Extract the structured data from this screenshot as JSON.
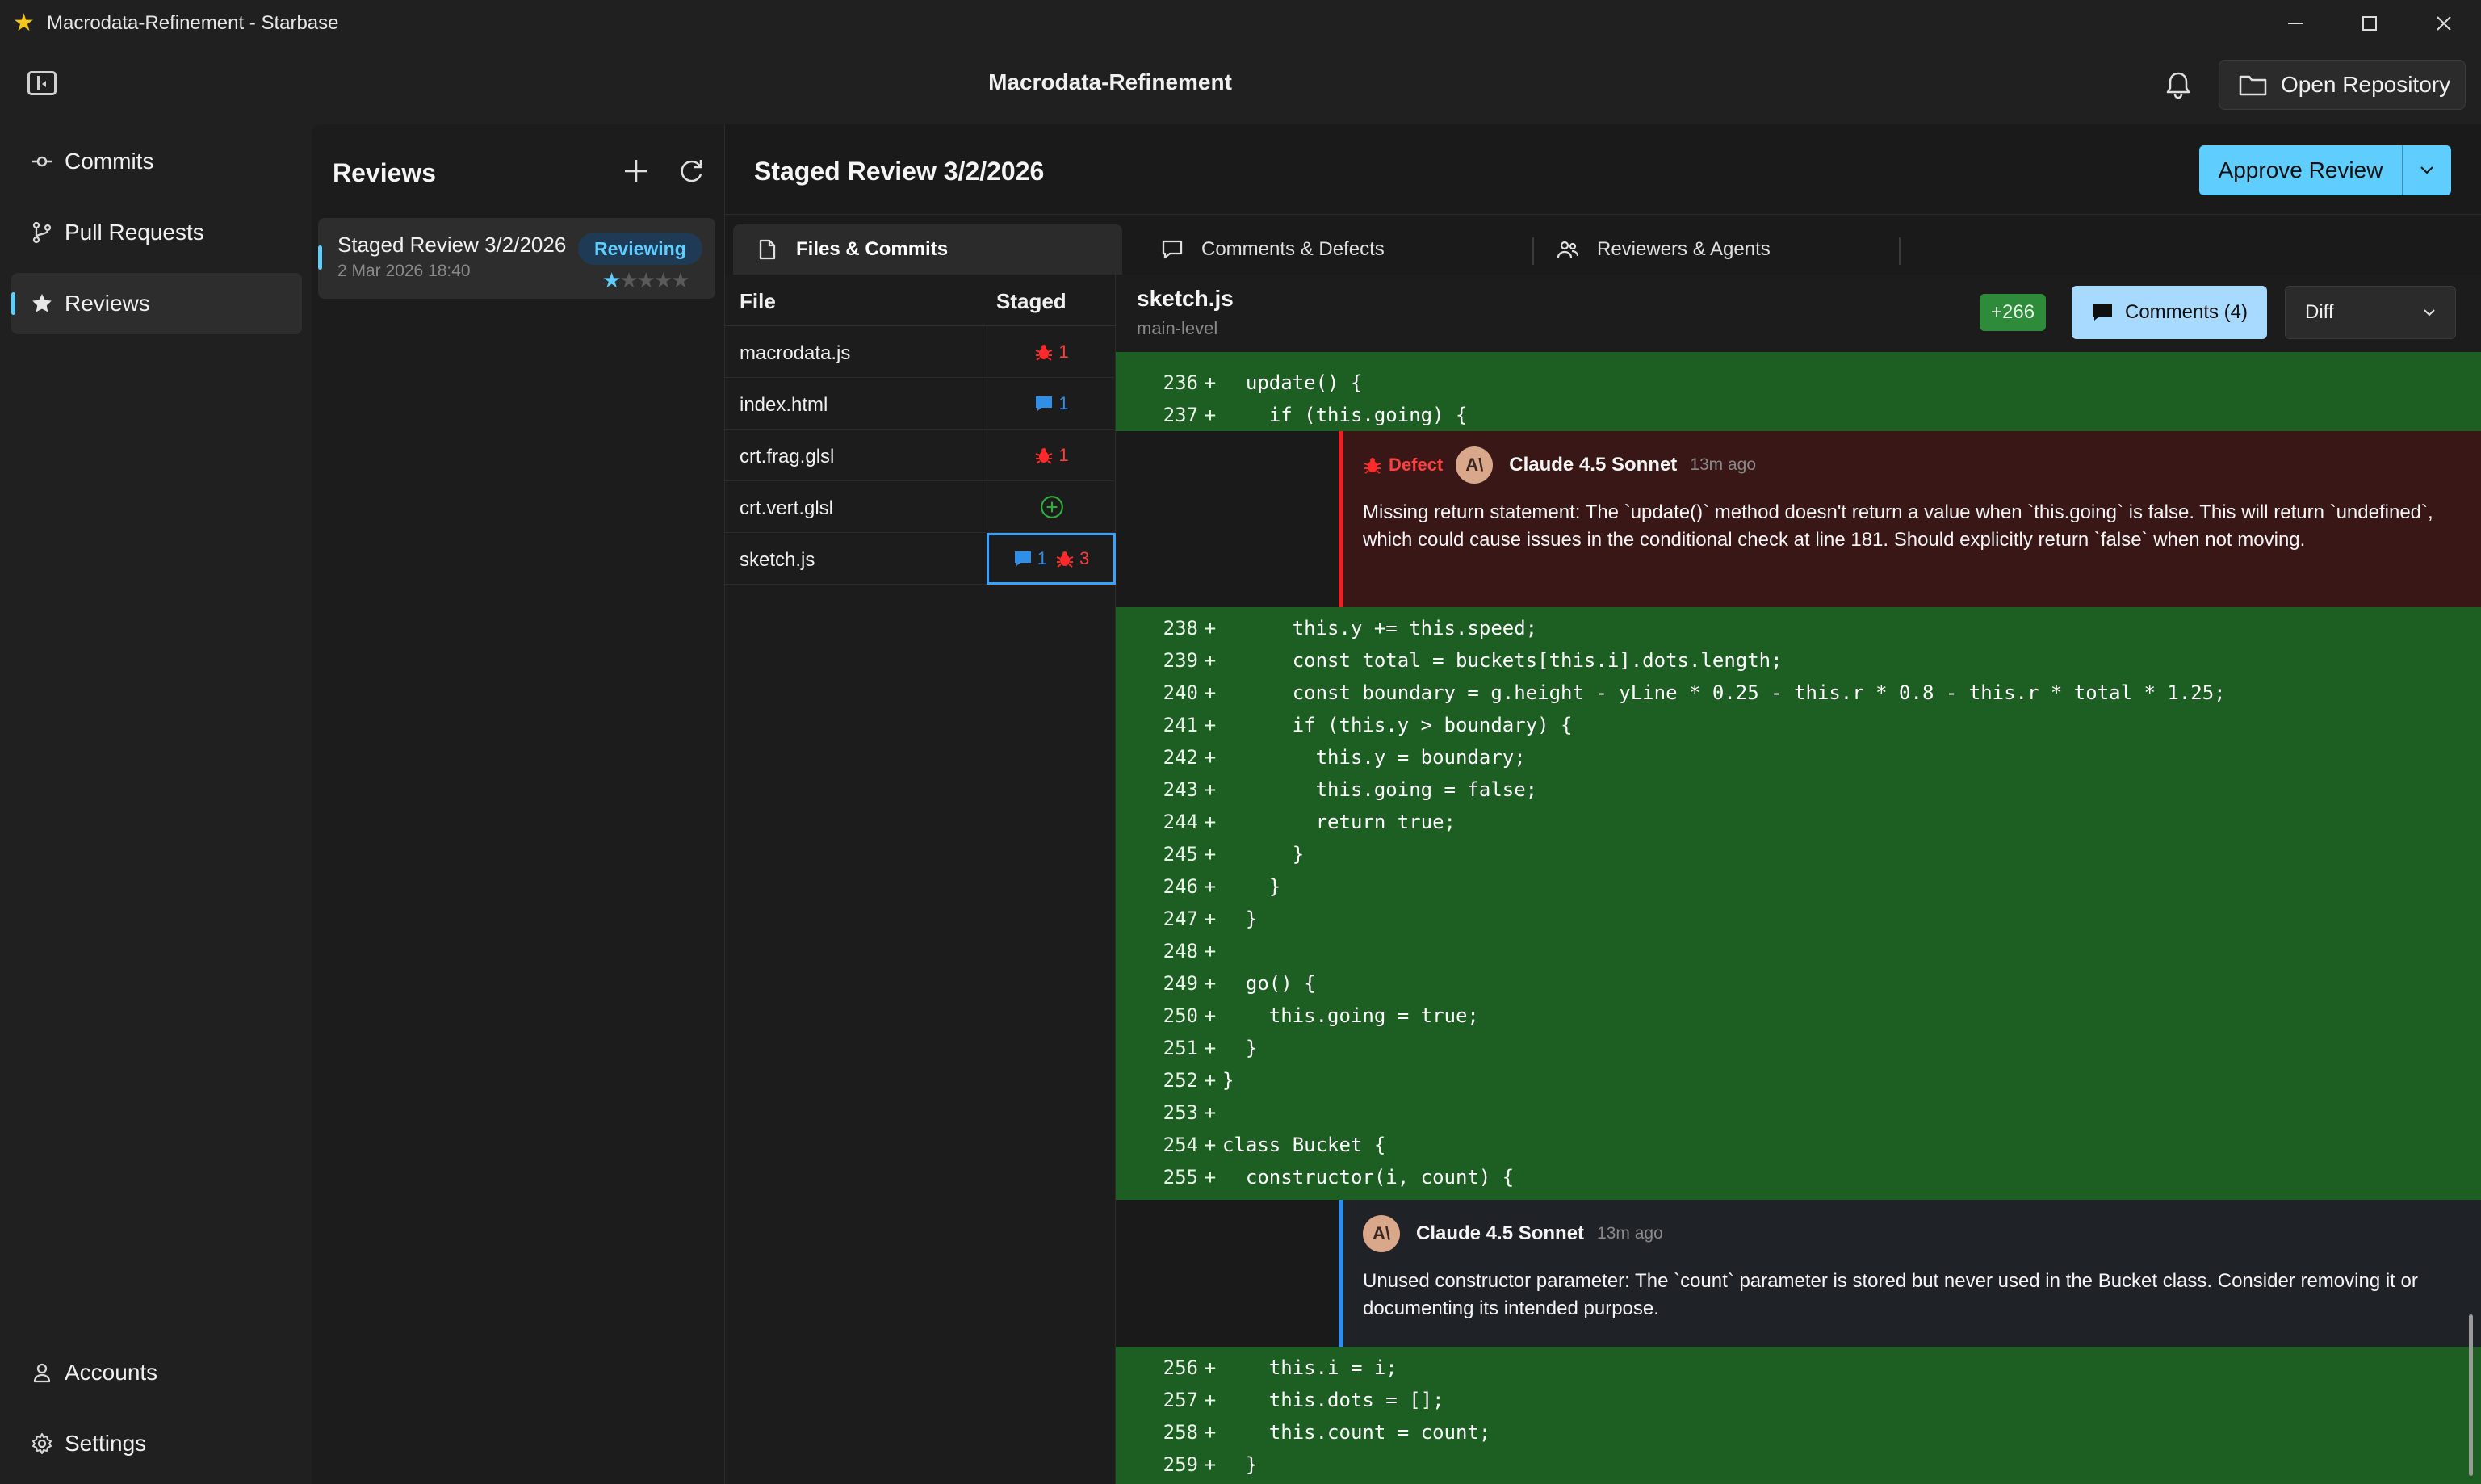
{
  "window": {
    "title": "Macrodata-Refinement - Starbase",
    "app_icon": "star-icon",
    "controls": [
      "minimize-icon",
      "maximize-icon",
      "close-icon"
    ]
  },
  "header": {
    "title": "Macrodata-Refinement",
    "open_repo_label": "Open Repository"
  },
  "nav": {
    "items": [
      {
        "label": "Commits",
        "icon": "commit-icon"
      },
      {
        "label": "Pull Requests",
        "icon": "pull-request-icon"
      },
      {
        "label": "Reviews",
        "icon": "star-icon",
        "active": true
      }
    ],
    "bottom": [
      {
        "label": "Accounts",
        "icon": "person-icon"
      },
      {
        "label": "Settings",
        "icon": "gear-icon"
      }
    ]
  },
  "reviews_panel": {
    "title": "Reviews",
    "items": [
      {
        "title": "Staged Review 3/2/2026",
        "date": "2 Mar 2026 18:40",
        "status": "Reviewing",
        "rating": 1,
        "rating_max": 5
      }
    ]
  },
  "review": {
    "title": "Staged Review 3/2/2026",
    "approve_label": "Approve Review",
    "tabs": [
      {
        "label": "Files & Commits",
        "icon": "file-icon",
        "active": true
      },
      {
        "label": "Comments & Defects",
        "icon": "chat-icon"
      },
      {
        "label": "Reviewers & Agents",
        "icon": "people-icon"
      }
    ]
  },
  "files": {
    "headers": {
      "file": "File",
      "staged": "Staged"
    },
    "rows": [
      {
        "name": "macrodata.js",
        "defects": "1"
      },
      {
        "name": "index.html",
        "comments": "1"
      },
      {
        "name": "crt.frag.glsl",
        "defects": "1"
      },
      {
        "name": "crt.vert.glsl",
        "added": true
      },
      {
        "name": "sketch.js",
        "comments": "1",
        "defects": "3",
        "selected": true
      }
    ]
  },
  "code": {
    "file_name": "sketch.js",
    "branch": "main-level",
    "added": "+266",
    "comments_label": "Comments (4)",
    "view_mode": "Diff",
    "blocks": [
      {
        "lines": [
          {
            "n": "236",
            "m": "+",
            "t": "  update() {"
          },
          {
            "n": "237",
            "m": "+",
            "t": "    if (this.going) {"
          }
        ]
      },
      {
        "lines": [
          {
            "n": "238",
            "m": "+",
            "t": "      this.y += this.speed;"
          },
          {
            "n": "239",
            "m": "+",
            "t": "      const total = buckets[this.i].dots.length;"
          },
          {
            "n": "240",
            "m": "+",
            "t": "      const boundary = g.height - yLine * 0.25 - this.r * 0.8 - this.r * total * 1.25;"
          },
          {
            "n": "241",
            "m": "+",
            "t": "      if (this.y > boundary) {"
          },
          {
            "n": "242",
            "m": "+",
            "t": "        this.y = boundary;"
          },
          {
            "n": "243",
            "m": "+",
            "t": "        this.going = false;"
          },
          {
            "n": "244",
            "m": "+",
            "t": "        return true;"
          },
          {
            "n": "245",
            "m": "+",
            "t": "      }"
          },
          {
            "n": "246",
            "m": "+",
            "t": "    }"
          },
          {
            "n": "247",
            "m": "+",
            "t": "  }"
          },
          {
            "n": "248",
            "m": "+",
            "t": ""
          },
          {
            "n": "249",
            "m": "+",
            "t": "  go() {"
          },
          {
            "n": "250",
            "m": "+",
            "t": "    this.going = true;"
          },
          {
            "n": "251",
            "m": "+",
            "t": "  }"
          },
          {
            "n": "252",
            "m": "+",
            "t": "}"
          },
          {
            "n": "253",
            "m": "+",
            "t": ""
          },
          {
            "n": "254",
            "m": "+",
            "t": "class Bucket {"
          },
          {
            "n": "255",
            "m": "+",
            "t": "  constructor(i, count) {"
          }
        ]
      },
      {
        "lines": [
          {
            "n": "256",
            "m": "+",
            "t": "    this.i = i;"
          },
          {
            "n": "257",
            "m": "+",
            "t": "    this.dots = [];"
          },
          {
            "n": "258",
            "m": "+",
            "t": "    this.count = count;"
          },
          {
            "n": "259",
            "m": "+",
            "t": "  }"
          }
        ]
      }
    ],
    "comments": [
      {
        "kind": "defect",
        "tag": "Defect",
        "avatar": "A\\",
        "author": "Claude 4.5 Sonnet",
        "time": "13m ago",
        "body": "Missing return statement: The `update()` method doesn't return a value when `this.going` is false. This will return `undefined`, which could cause issues in the conditional check at line 181. Should explicitly return `false` when not moving."
      },
      {
        "kind": "note",
        "avatar": "A\\",
        "author": "Claude 4.5 Sonnet",
        "time": "13m ago",
        "body": "Unused constructor parameter: The `count` parameter is stored but never used in the Bucket class. Consider removing it or documenting its intended purpose."
      }
    ]
  },
  "colors": {
    "accent": "#60cdff",
    "added_bg": "#1d5e22",
    "defect": "#e52525",
    "comment": "#2f8fe8"
  }
}
